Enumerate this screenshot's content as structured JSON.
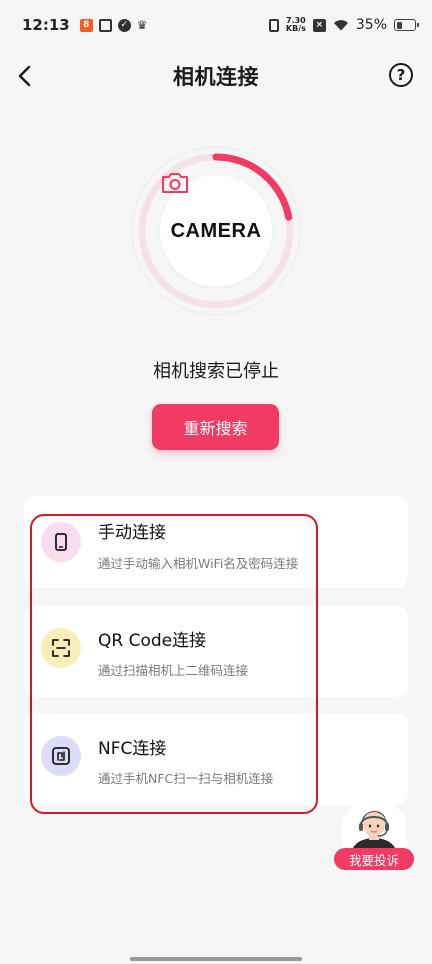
{
  "status_bar": {
    "time": "12:13",
    "net_speed_value": "7.30",
    "net_speed_unit": "KB/s",
    "battery": "35%",
    "notif_icons": [
      "app-badge-icon",
      "box-icon",
      "check-circle-icon",
      "crown-icon"
    ],
    "sys_icons": [
      "vibrate-icon",
      "speed-icon",
      "x-badge-icon",
      "wifi-icon",
      "battery-icon"
    ]
  },
  "header": {
    "title": "相机连接",
    "back_icon": "chevron-left-icon",
    "help_icon": "question-circle-icon",
    "help_glyph": "?"
  },
  "camera": {
    "label": "CAMERA",
    "icon": "camera-icon",
    "progress_fraction": 0.22
  },
  "search": {
    "status_text": "相机搜索已停止",
    "button_label": "重新搜索"
  },
  "options": [
    {
      "title": "手动连接",
      "desc": "通过手动输入相机WiFi名及密码连接",
      "icon": "phone-icon",
      "icon_bg": "#f8dcef"
    },
    {
      "title": "QR Code连接",
      "desc": "通过扫描相机上二维码连接",
      "icon": "scan-icon",
      "icon_bg": "#f8eeb8"
    },
    {
      "title": "NFC连接",
      "desc": "通过手机NFC扫一扫与相机连接",
      "icon": "nfc-icon",
      "icon_bg": "#dcdcf8"
    }
  ],
  "support": {
    "label": "我要投诉",
    "icon": "customer-service-avatar"
  },
  "colors": {
    "accent": "#f23b63",
    "highlight_border": "#d01c2a",
    "background": "#f6f6f6"
  }
}
